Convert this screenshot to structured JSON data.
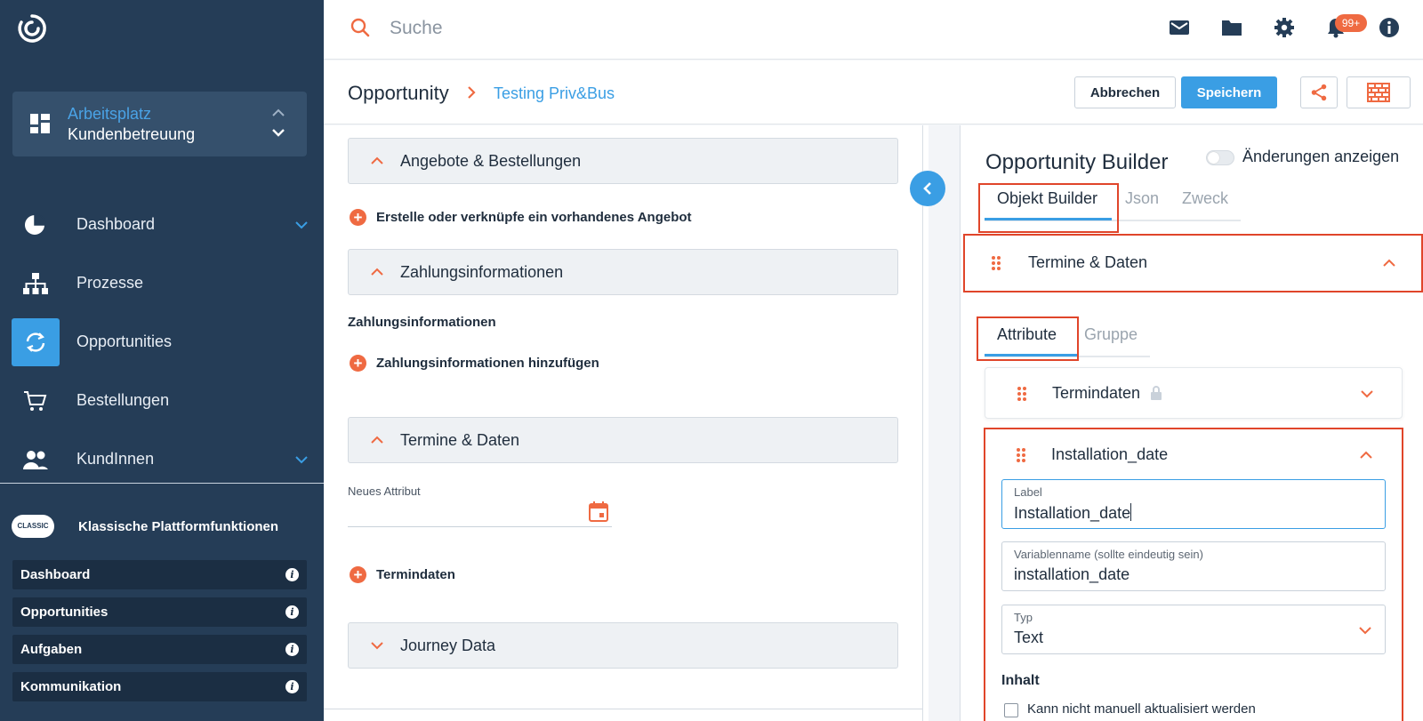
{
  "search": {
    "placeholder": "Suche"
  },
  "notifications": {
    "badge": "99+"
  },
  "workspace": {
    "title": "Arbeitsplatz",
    "subtitle": "Kundenbetreuung"
  },
  "nav": {
    "items": [
      {
        "label": "Dashboard"
      },
      {
        "label": "Prozesse"
      },
      {
        "label": "Opportunities"
      },
      {
        "label": "Bestellungen"
      },
      {
        "label": "KundInnen"
      }
    ]
  },
  "classic": {
    "badge": "CLASSIC",
    "title": "Klassische Plattformfunktionen",
    "items": [
      {
        "label": "Dashboard"
      },
      {
        "label": "Opportunities"
      },
      {
        "label": "Aufgaben"
      },
      {
        "label": "Kommunikation"
      }
    ]
  },
  "breadcrumb": {
    "main": "Opportunity",
    "sub": "Testing Priv&Bus"
  },
  "actions": {
    "cancel": "Abbrechen",
    "save": "Speichern"
  },
  "form": {
    "sections": [
      {
        "title": "Angebote & Bestellungen"
      },
      {
        "title": "Zahlungsinformationen"
      },
      {
        "title": "Termine & Daten"
      },
      {
        "title": "Journey Data"
      }
    ],
    "add_offer": "Erstelle oder verknüpfe ein vorhandenes Angebot",
    "payment_label": "Zahlungsinformationen",
    "add_payment": "Zahlungsinformationen hinzufügen",
    "new_attribute_label": "Neues Attribut",
    "add_termindaten": "Termindaten"
  },
  "builder": {
    "title": "Opportunity Builder",
    "toggle_label": "Änderungen anzeigen",
    "tabs": [
      {
        "label": "Objekt Builder"
      },
      {
        "label": "Json"
      },
      {
        "label": "Zweck"
      }
    ],
    "group_title": "Termine & Daten",
    "sub_tabs": [
      {
        "label": "Attribute"
      },
      {
        "label": "Gruppe"
      }
    ],
    "attr1_title": "Termindaten",
    "attr2_title": "Installation_date",
    "fields": {
      "label": {
        "label": "Label",
        "value": "Installation_date"
      },
      "varname": {
        "label": "Variablenname (sollte eindeutig sein)",
        "value": "installation_date"
      },
      "type": {
        "label": "Typ",
        "value": "Text"
      }
    },
    "inhalt": "Inhalt",
    "checkbox_label": "Kann nicht manuell aktualisiert werden"
  },
  "colors": {
    "accent": "#3a9ee4",
    "brand_orange": "#ef6a42",
    "sidebar": "#253d57",
    "highlight_red": "#e0452a"
  }
}
